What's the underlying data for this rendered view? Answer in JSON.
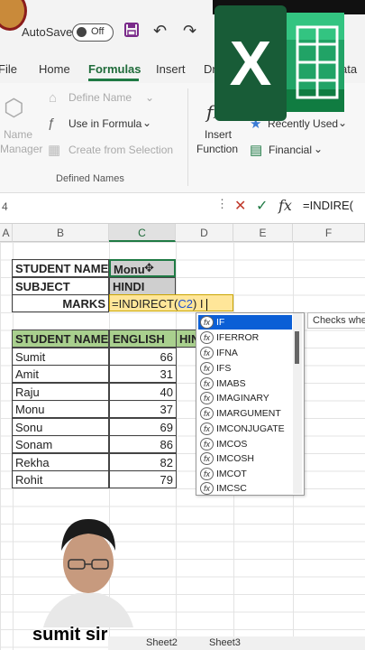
{
  "titlebar": {
    "autosave_label": "AutoSave",
    "toggle_state": "Off"
  },
  "menu": {
    "items": [
      "File",
      "Home",
      "Formulas",
      "Insert",
      "Dr",
      "ata"
    ]
  },
  "ribbon": {
    "define_name": "Define Name",
    "use_in_formula": "Use in Formula",
    "create_from_selection": "Create from Selection",
    "name_manager_1": "Name",
    "name_manager_2": "Manager",
    "defined_names_group": "Defined Names",
    "insert_function_1": "Insert",
    "insert_function_2": "Function",
    "recently_used": "Recently Used",
    "financial": "Financial"
  },
  "formula_bar": {
    "name_box": "4",
    "formula": "=INDIRE("
  },
  "columns": [
    "A",
    "B",
    "C",
    "D",
    "E",
    "F"
  ],
  "info_table": {
    "labels": [
      "STUDENT NAME",
      "SUBJECT",
      "MARKS"
    ],
    "values": [
      "Monu",
      "HINDI"
    ],
    "edit_prefix": "=INDIRECT(",
    "edit_ref": "C2",
    "edit_suffix": ") I"
  },
  "marks_table": {
    "headers": [
      "STUDENT NAME",
      "ENGLISH",
      "HIN"
    ],
    "rows": [
      {
        "name": "Sumit",
        "english": "66"
      },
      {
        "name": "Amit",
        "english": "31"
      },
      {
        "name": "Raju",
        "english": "40"
      },
      {
        "name": "Monu",
        "english": "37"
      },
      {
        "name": "Sonu",
        "english": "69"
      },
      {
        "name": "Sonam",
        "english": "86"
      },
      {
        "name": "Rekha",
        "english": "82"
      },
      {
        "name": "Rohit",
        "english": "79"
      }
    ]
  },
  "autocomplete": {
    "items": [
      "IF",
      "IFERROR",
      "IFNA",
      "IFS",
      "IMABS",
      "IMAGINARY",
      "IMARGUMENT",
      "IMCONJUGATE",
      "IMCOS",
      "IMCOSH",
      "IMCOT",
      "IMCSC"
    ],
    "tooltip": "Checks whe"
  },
  "overlay": {
    "caption": "sumit sir"
  },
  "sheet_tabs": [
    "Sheet2",
    "Sheet3"
  ],
  "colors": {
    "excel_green": "#1f7a44",
    "header_green": "#a9d08e",
    "selected_blue": "#0b5fd6",
    "edit_yellow": "#ffe699"
  }
}
